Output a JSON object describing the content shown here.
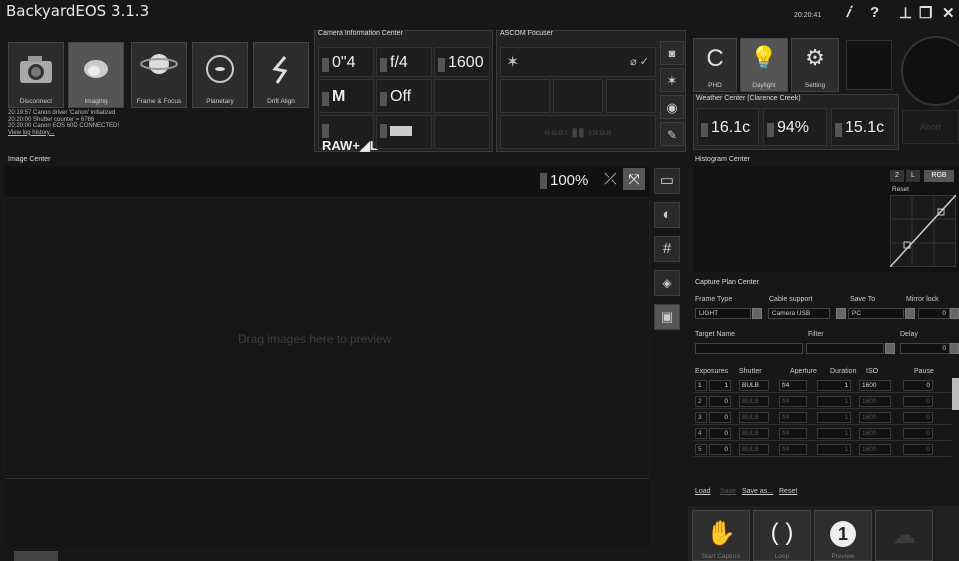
{
  "app": {
    "title": "BackyardEOS 3.1.3",
    "clock": "20:20:41"
  },
  "header_icons": [
    "info-icon",
    "help-icon",
    "upload-icon",
    "restore-icon",
    "close-icon"
  ],
  "modes": {
    "camera_label": "Disconnect",
    "imaging_label": "Imaging",
    "frame_focus_label": "Frame & Focus",
    "planetary_label": "Planetary",
    "drift_align_label": "Drift Align"
  },
  "status_log": [
    "20:19:57 Canon driver 'Canon' initialized",
    "20:20:00 Shutter counter = 6786",
    "20:20:00 Canon EOS 60D CONNECTED!"
  ],
  "view_log_link": "View log history...",
  "camera_info": {
    "title": "Camera Information Center",
    "shutter": "0\"4",
    "aperture": "f/4",
    "iso": "1600",
    "mode": "M",
    "bulb": "Off",
    "quality": "RAW+◢L"
  },
  "focuser": {
    "title": "ASCOM Focuser",
    "nav": "«««‹ ▮▮ ›»»»"
  },
  "weather": {
    "title": "Weather Center (Clarence Creek)",
    "phd_label": "PHD",
    "daylight_label": "Daylight",
    "setting_label": "Setting",
    "temperature": "16.1c",
    "humidity": "94%",
    "dewpoint": "15.1c",
    "abort_label": "Abort"
  },
  "image_center": {
    "title": "Image Center",
    "zoom": "100%",
    "placeholder": "Drag images here to preview"
  },
  "histogram": {
    "title": "Histogram Center",
    "btn_2": "2",
    "btn_l": "L",
    "btn_rgb": "RGB",
    "reset": "Reset"
  },
  "capture_plan": {
    "title": "Capture Plan Center",
    "frame_type_label": "Frame Type",
    "frame_type": "LIGHT",
    "cable_label": "Cable support",
    "cable": "Camera USB",
    "save_label": "Save To",
    "save": "PC",
    "mirror_label": "Mirror lock",
    "mirror": "0",
    "target_label": "Target Name",
    "filter_label": "Filter",
    "delay_label": "Delay",
    "delay": "0",
    "headers": [
      "Exposures",
      "Shutter",
      "Aperture",
      "Duration",
      "ISO",
      "Pause"
    ],
    "rows": [
      {
        "n": "1",
        "exp": "1",
        "shutter": "BULB",
        "aperture": "f/4",
        "duration": "1",
        "iso": "1600",
        "pause": "0"
      },
      {
        "n": "2",
        "exp": "0",
        "shutter": "BULB",
        "aperture": "f/4",
        "duration": "1",
        "iso": "1600",
        "pause": "0"
      },
      {
        "n": "3",
        "exp": "0",
        "shutter": "BULB",
        "aperture": "f/4",
        "duration": "1",
        "iso": "1600",
        "pause": "0"
      },
      {
        "n": "4",
        "exp": "0",
        "shutter": "BULB",
        "aperture": "f/4",
        "duration": "1",
        "iso": "1600",
        "pause": "0"
      },
      {
        "n": "5",
        "exp": "0",
        "shutter": "BULB",
        "aperture": "f/4",
        "duration": "1",
        "iso": "1600",
        "pause": "0"
      }
    ],
    "load": "Load",
    "save_link": "Save",
    "save_as": "Save as...",
    "reset": "Reset"
  },
  "actions": {
    "start_label": "Start Capture",
    "loop_label": "Loop",
    "preview_label": "Preview"
  },
  "colors": {
    "background": "#171717",
    "panel": "#232323",
    "active": "#555555"
  }
}
